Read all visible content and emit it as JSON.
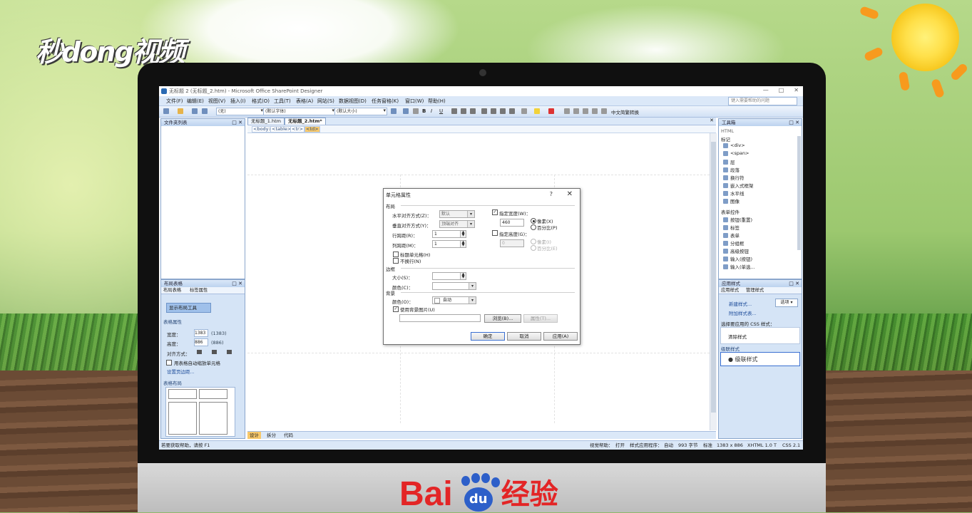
{
  "watermark": {
    "top_left": "秒dong视频",
    "bottom_brand_latin": "Bai",
    "bottom_brand_paw": "du",
    "bottom_brand_cn": "经验"
  },
  "window": {
    "title": "无标题 2 (无标题_2.htm) - Microsoft Office SharePoint Designer",
    "controls": [
      "—",
      "□",
      "✕"
    ]
  },
  "menu": {
    "items": [
      "文件(F)",
      "编辑(E)",
      "视图(V)",
      "插入(I)",
      "格式(O)",
      "工具(T)",
      "表格(A)",
      "网站(S)",
      "数据视图(D)",
      "任务窗格(K)",
      "窗口(W)",
      "帮助(H)"
    ],
    "help_placeholder": "键入需要帮助的问题"
  },
  "toolbar": {
    "style_combo": "(无)",
    "font_combo": "(默认字体)",
    "size_combo": "(默认大小)",
    "bold": "B",
    "italic": "I",
    "underline": "U",
    "convert_label": "中文简繁转换"
  },
  "folder_list": {
    "title": "文件夹列表"
  },
  "layout_tables": {
    "tabs": [
      "布局表格",
      "标签属性"
    ],
    "show_tools": "显示布局工具",
    "section_props": "表格属性",
    "width_label": "宽度：",
    "width_value": "1383",
    "width_hint": "(1383)",
    "height_label": "高度：",
    "height_value": "886",
    "height_hint": "(886)",
    "align_label": "对齐方式：",
    "autofit": "用表格自动缩放单元格",
    "page_margins": "设置页边距...",
    "section_layout": "表格布局"
  },
  "editor": {
    "tabs": [
      "无标题_1.htm",
      "无标题_2.htm*"
    ],
    "breadcrumb": [
      "<body>",
      "<table>",
      "<tr>",
      "<td>"
    ],
    "view_tabs": [
      "设计",
      "拆分",
      "代码"
    ]
  },
  "toolbox": {
    "title": "工具箱",
    "group_html": "HTML",
    "group_tags": "标记",
    "tag_items": [
      "<div>",
      "<span>",
      "层",
      "段落",
      "换行符",
      "嵌入式框架",
      "水平线",
      "图像"
    ],
    "group_form": "表单控件",
    "form_items": [
      "按钮(重置)",
      "标签",
      "表单",
      "分组框",
      "高级按钮",
      "输入(按钮)",
      "输入(单选..."
    ]
  },
  "apply_styles": {
    "title": "应用样式",
    "tabs": [
      "应用样式",
      "管理样式"
    ],
    "new_style": "新建样式...",
    "attach": "附加样式表...",
    "options": "选项 ▾",
    "select_label": "选择要应用的 CSS 样式：",
    "clear": "清除样式",
    "inline_group": "级联样式",
    "inline_item": "级联样式"
  },
  "status": {
    "left": "若要获取帮助，请按 F1",
    "right_items": [
      "视觉帮助：",
      "打开",
      "样式应用程序：",
      "自动",
      "993 字节",
      "标准",
      "1383 x 886",
      "XHTML 1.0 T",
      "CSS 2.1"
    ]
  },
  "dialog": {
    "title": "单元格属性",
    "help": "?",
    "close": "✕",
    "section_layout": "布局",
    "halign_label": "水平对齐方式(Z)：",
    "halign_value": "默认",
    "valign_label": "垂直对齐方式(Y)：",
    "valign_value": "顶端对齐",
    "rowspan_label": "行跨距(R)：",
    "rowspan_value": "1",
    "colspan_label": "列跨距(M)：",
    "colspan_value": "1",
    "header_cell": "标题单元格(H)",
    "no_wrap": "不换行(N)",
    "spec_width": "指定宽度(W)：",
    "width_value": "460",
    "pixels": "像素(X)",
    "percent": "百分比(P)",
    "spec_height": "指定高度(G)：",
    "height_value": "0",
    "pixels2": "像素(I)",
    "percent2": "百分比(E)",
    "section_border": "边框",
    "size_label": "大小(S)：",
    "color_label": "颜色(C)：",
    "section_background": "背景",
    "bgcolor_label": "颜色(O)：",
    "bgcolor_value": "自动",
    "use_bg_image": "使用背景图片(U)",
    "browse": "浏览(B)...",
    "properties": "属性(T)...",
    "ok": "确定",
    "cancel": "取消",
    "apply": "应用(A)"
  }
}
